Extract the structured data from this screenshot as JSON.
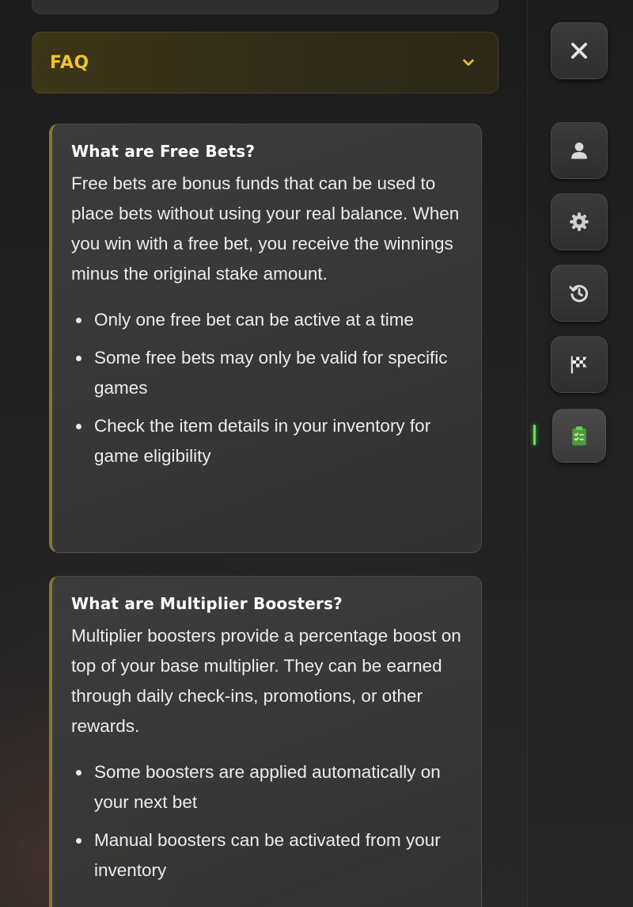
{
  "faq": {
    "title": "FAQ",
    "expanded_icon": "chevron-down-icon",
    "accent_color": "#f1c232"
  },
  "cards": [
    {
      "title": "What are Free Bets?",
      "body": "Free bets are bonus funds that can be used to place bets without using your real balance. When you win with a free bet, you receive the winnings minus the original stake amount.",
      "bullets": [
        "Only one free bet can be active at a time",
        "Some free bets may only be valid for specific games",
        "Check the item details in your inventory for game eligibility"
      ]
    },
    {
      "title": "What are Multiplier Boosters?",
      "body": "Multiplier boosters provide a percentage boost on top of your base multiplier. They can be earned through daily check-ins, promotions, or other rewards.",
      "bullets": [
        "Some boosters are applied automatically on your next bet",
        "Manual boosters can be activated from your inventory"
      ]
    }
  ],
  "sidebar": {
    "items": [
      {
        "icon": "close-icon"
      },
      {
        "icon": "user-icon"
      },
      {
        "icon": "gear-icon"
      },
      {
        "icon": "history-icon"
      },
      {
        "icon": "checkered-flag-icon"
      },
      {
        "icon": "clipboard-check-icon",
        "active": true
      }
    ],
    "active_color": "#5ce65c"
  }
}
